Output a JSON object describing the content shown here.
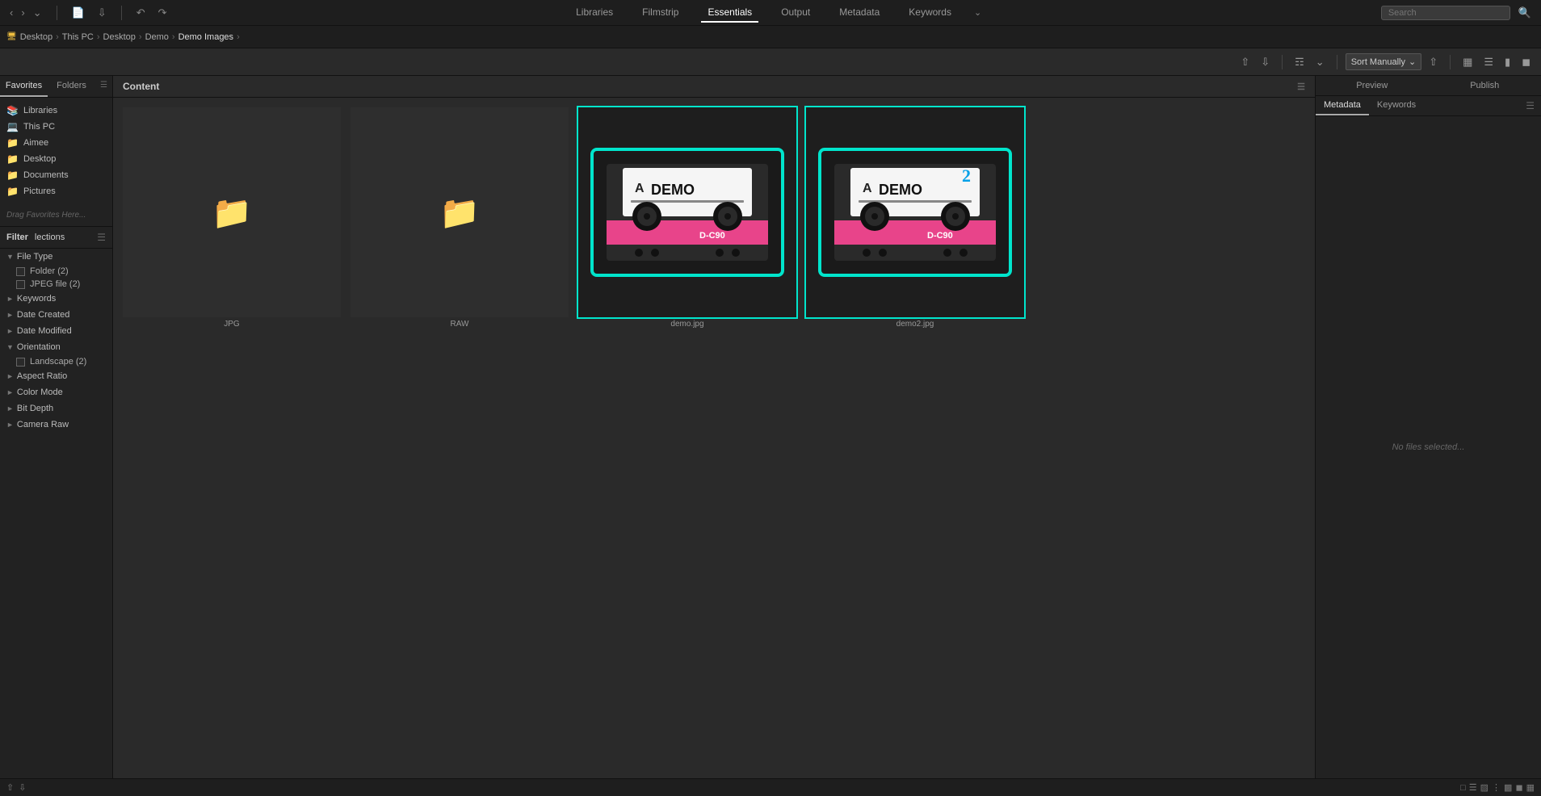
{
  "topNav": {
    "tabs": [
      {
        "label": "Libraries",
        "active": false
      },
      {
        "label": "Filmstrip",
        "active": false
      },
      {
        "label": "Essentials",
        "active": true
      },
      {
        "label": "Output",
        "active": false
      },
      {
        "label": "Metadata",
        "active": false
      },
      {
        "label": "Keywords",
        "active": false
      }
    ],
    "searchPlaceholder": "Search"
  },
  "breadcrumb": {
    "items": [
      {
        "label": "Desktop",
        "icon": "🖥"
      },
      {
        "label": "This PC",
        "icon": "💻"
      },
      {
        "label": "Desktop",
        "icon": "🖥"
      },
      {
        "label": "Demo",
        "icon": "📁"
      },
      {
        "label": "Demo Images",
        "icon": "📁",
        "active": true
      }
    ]
  },
  "toolbar": {
    "sort_label": "Sort Manually"
  },
  "leftPanel": {
    "tabs": [
      {
        "label": "Favorites",
        "active": true
      },
      {
        "label": "Folders",
        "active": false
      }
    ],
    "favorites": [
      {
        "label": "Libraries",
        "icon": "📚",
        "type": "blue"
      },
      {
        "label": "This PC",
        "icon": "💻",
        "type": "blue"
      },
      {
        "label": "Aimee",
        "icon": "📁",
        "type": "yellow"
      },
      {
        "label": "Desktop",
        "icon": "📁",
        "type": "yellow"
      },
      {
        "label": "Documents",
        "icon": "📁",
        "type": "yellow"
      },
      {
        "label": "Pictures",
        "icon": "📁",
        "type": "yellow"
      }
    ],
    "dragHint": "Drag Favorites Here..."
  },
  "filterPanel": {
    "filterLabel": "Filter",
    "sectionsLabel": "lections",
    "sections": [
      {
        "label": "File Type",
        "expanded": true,
        "items": [
          {
            "label": "Folder (2)",
            "checked": false
          },
          {
            "label": "JPEG file (2)",
            "checked": false
          }
        ]
      },
      {
        "label": "Keywords",
        "expanded": false,
        "items": []
      },
      {
        "label": "Date Created",
        "expanded": false,
        "items": []
      },
      {
        "label": "Date Modified",
        "expanded": false,
        "items": []
      },
      {
        "label": "Orientation",
        "expanded": true,
        "items": [
          {
            "label": "Landscape (2)",
            "checked": false
          }
        ]
      },
      {
        "label": "Aspect Ratio",
        "expanded": false,
        "items": []
      },
      {
        "label": "Color Mode",
        "expanded": false,
        "items": []
      },
      {
        "label": "Bit Depth",
        "expanded": false,
        "items": []
      },
      {
        "label": "Camera Raw",
        "expanded": false,
        "items": []
      }
    ]
  },
  "content": {
    "header": "Content",
    "items": [
      {
        "label": "JPG",
        "type": "folder"
      },
      {
        "label": "RAW",
        "type": "folder"
      },
      {
        "label": "demo.jpg",
        "type": "cassette1",
        "selected": true
      },
      {
        "label": "demo2.jpg",
        "type": "cassette2",
        "selected": true
      }
    ]
  },
  "rightPanel": {
    "topTabs": [
      {
        "label": "Preview",
        "active": false
      },
      {
        "label": "Publish",
        "active": false
      }
    ],
    "metaTabs": [
      {
        "label": "Metadata",
        "active": true
      },
      {
        "label": "Keywords",
        "active": false
      }
    ],
    "noFilesMsg": "No files selected..."
  }
}
